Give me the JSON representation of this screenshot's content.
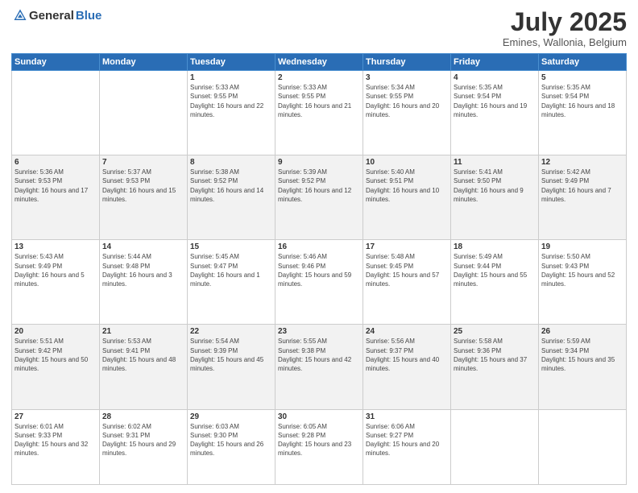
{
  "header": {
    "logo_general": "General",
    "logo_blue": "Blue",
    "month": "July 2025",
    "location": "Emines, Wallonia, Belgium"
  },
  "days_of_week": [
    "Sunday",
    "Monday",
    "Tuesday",
    "Wednesday",
    "Thursday",
    "Friday",
    "Saturday"
  ],
  "weeks": [
    [
      {
        "day": "",
        "sunrise": "",
        "sunset": "",
        "daylight": ""
      },
      {
        "day": "",
        "sunrise": "",
        "sunset": "",
        "daylight": ""
      },
      {
        "day": "1",
        "sunrise": "Sunrise: 5:33 AM",
        "sunset": "Sunset: 9:55 PM",
        "daylight": "Daylight: 16 hours and 22 minutes."
      },
      {
        "day": "2",
        "sunrise": "Sunrise: 5:33 AM",
        "sunset": "Sunset: 9:55 PM",
        "daylight": "Daylight: 16 hours and 21 minutes."
      },
      {
        "day": "3",
        "sunrise": "Sunrise: 5:34 AM",
        "sunset": "Sunset: 9:55 PM",
        "daylight": "Daylight: 16 hours and 20 minutes."
      },
      {
        "day": "4",
        "sunrise": "Sunrise: 5:35 AM",
        "sunset": "Sunset: 9:54 PM",
        "daylight": "Daylight: 16 hours and 19 minutes."
      },
      {
        "day": "5",
        "sunrise": "Sunrise: 5:35 AM",
        "sunset": "Sunset: 9:54 PM",
        "daylight": "Daylight: 16 hours and 18 minutes."
      }
    ],
    [
      {
        "day": "6",
        "sunrise": "Sunrise: 5:36 AM",
        "sunset": "Sunset: 9:53 PM",
        "daylight": "Daylight: 16 hours and 17 minutes."
      },
      {
        "day": "7",
        "sunrise": "Sunrise: 5:37 AM",
        "sunset": "Sunset: 9:53 PM",
        "daylight": "Daylight: 16 hours and 15 minutes."
      },
      {
        "day": "8",
        "sunrise": "Sunrise: 5:38 AM",
        "sunset": "Sunset: 9:52 PM",
        "daylight": "Daylight: 16 hours and 14 minutes."
      },
      {
        "day": "9",
        "sunrise": "Sunrise: 5:39 AM",
        "sunset": "Sunset: 9:52 PM",
        "daylight": "Daylight: 16 hours and 12 minutes."
      },
      {
        "day": "10",
        "sunrise": "Sunrise: 5:40 AM",
        "sunset": "Sunset: 9:51 PM",
        "daylight": "Daylight: 16 hours and 10 minutes."
      },
      {
        "day": "11",
        "sunrise": "Sunrise: 5:41 AM",
        "sunset": "Sunset: 9:50 PM",
        "daylight": "Daylight: 16 hours and 9 minutes."
      },
      {
        "day": "12",
        "sunrise": "Sunrise: 5:42 AM",
        "sunset": "Sunset: 9:49 PM",
        "daylight": "Daylight: 16 hours and 7 minutes."
      }
    ],
    [
      {
        "day": "13",
        "sunrise": "Sunrise: 5:43 AM",
        "sunset": "Sunset: 9:49 PM",
        "daylight": "Daylight: 16 hours and 5 minutes."
      },
      {
        "day": "14",
        "sunrise": "Sunrise: 5:44 AM",
        "sunset": "Sunset: 9:48 PM",
        "daylight": "Daylight: 16 hours and 3 minutes."
      },
      {
        "day": "15",
        "sunrise": "Sunrise: 5:45 AM",
        "sunset": "Sunset: 9:47 PM",
        "daylight": "Daylight: 16 hours and 1 minute."
      },
      {
        "day": "16",
        "sunrise": "Sunrise: 5:46 AM",
        "sunset": "Sunset: 9:46 PM",
        "daylight": "Daylight: 15 hours and 59 minutes."
      },
      {
        "day": "17",
        "sunrise": "Sunrise: 5:48 AM",
        "sunset": "Sunset: 9:45 PM",
        "daylight": "Daylight: 15 hours and 57 minutes."
      },
      {
        "day": "18",
        "sunrise": "Sunrise: 5:49 AM",
        "sunset": "Sunset: 9:44 PM",
        "daylight": "Daylight: 15 hours and 55 minutes."
      },
      {
        "day": "19",
        "sunrise": "Sunrise: 5:50 AM",
        "sunset": "Sunset: 9:43 PM",
        "daylight": "Daylight: 15 hours and 52 minutes."
      }
    ],
    [
      {
        "day": "20",
        "sunrise": "Sunrise: 5:51 AM",
        "sunset": "Sunset: 9:42 PM",
        "daylight": "Daylight: 15 hours and 50 minutes."
      },
      {
        "day": "21",
        "sunrise": "Sunrise: 5:53 AM",
        "sunset": "Sunset: 9:41 PM",
        "daylight": "Daylight: 15 hours and 48 minutes."
      },
      {
        "day": "22",
        "sunrise": "Sunrise: 5:54 AM",
        "sunset": "Sunset: 9:39 PM",
        "daylight": "Daylight: 15 hours and 45 minutes."
      },
      {
        "day": "23",
        "sunrise": "Sunrise: 5:55 AM",
        "sunset": "Sunset: 9:38 PM",
        "daylight": "Daylight: 15 hours and 42 minutes."
      },
      {
        "day": "24",
        "sunrise": "Sunrise: 5:56 AM",
        "sunset": "Sunset: 9:37 PM",
        "daylight": "Daylight: 15 hours and 40 minutes."
      },
      {
        "day": "25",
        "sunrise": "Sunrise: 5:58 AM",
        "sunset": "Sunset: 9:36 PM",
        "daylight": "Daylight: 15 hours and 37 minutes."
      },
      {
        "day": "26",
        "sunrise": "Sunrise: 5:59 AM",
        "sunset": "Sunset: 9:34 PM",
        "daylight": "Daylight: 15 hours and 35 minutes."
      }
    ],
    [
      {
        "day": "27",
        "sunrise": "Sunrise: 6:01 AM",
        "sunset": "Sunset: 9:33 PM",
        "daylight": "Daylight: 15 hours and 32 minutes."
      },
      {
        "day": "28",
        "sunrise": "Sunrise: 6:02 AM",
        "sunset": "Sunset: 9:31 PM",
        "daylight": "Daylight: 15 hours and 29 minutes."
      },
      {
        "day": "29",
        "sunrise": "Sunrise: 6:03 AM",
        "sunset": "Sunset: 9:30 PM",
        "daylight": "Daylight: 15 hours and 26 minutes."
      },
      {
        "day": "30",
        "sunrise": "Sunrise: 6:05 AM",
        "sunset": "Sunset: 9:28 PM",
        "daylight": "Daylight: 15 hours and 23 minutes."
      },
      {
        "day": "31",
        "sunrise": "Sunrise: 6:06 AM",
        "sunset": "Sunset: 9:27 PM",
        "daylight": "Daylight: 15 hours and 20 minutes."
      },
      {
        "day": "",
        "sunrise": "",
        "sunset": "",
        "daylight": ""
      },
      {
        "day": "",
        "sunrise": "",
        "sunset": "",
        "daylight": ""
      }
    ]
  ]
}
